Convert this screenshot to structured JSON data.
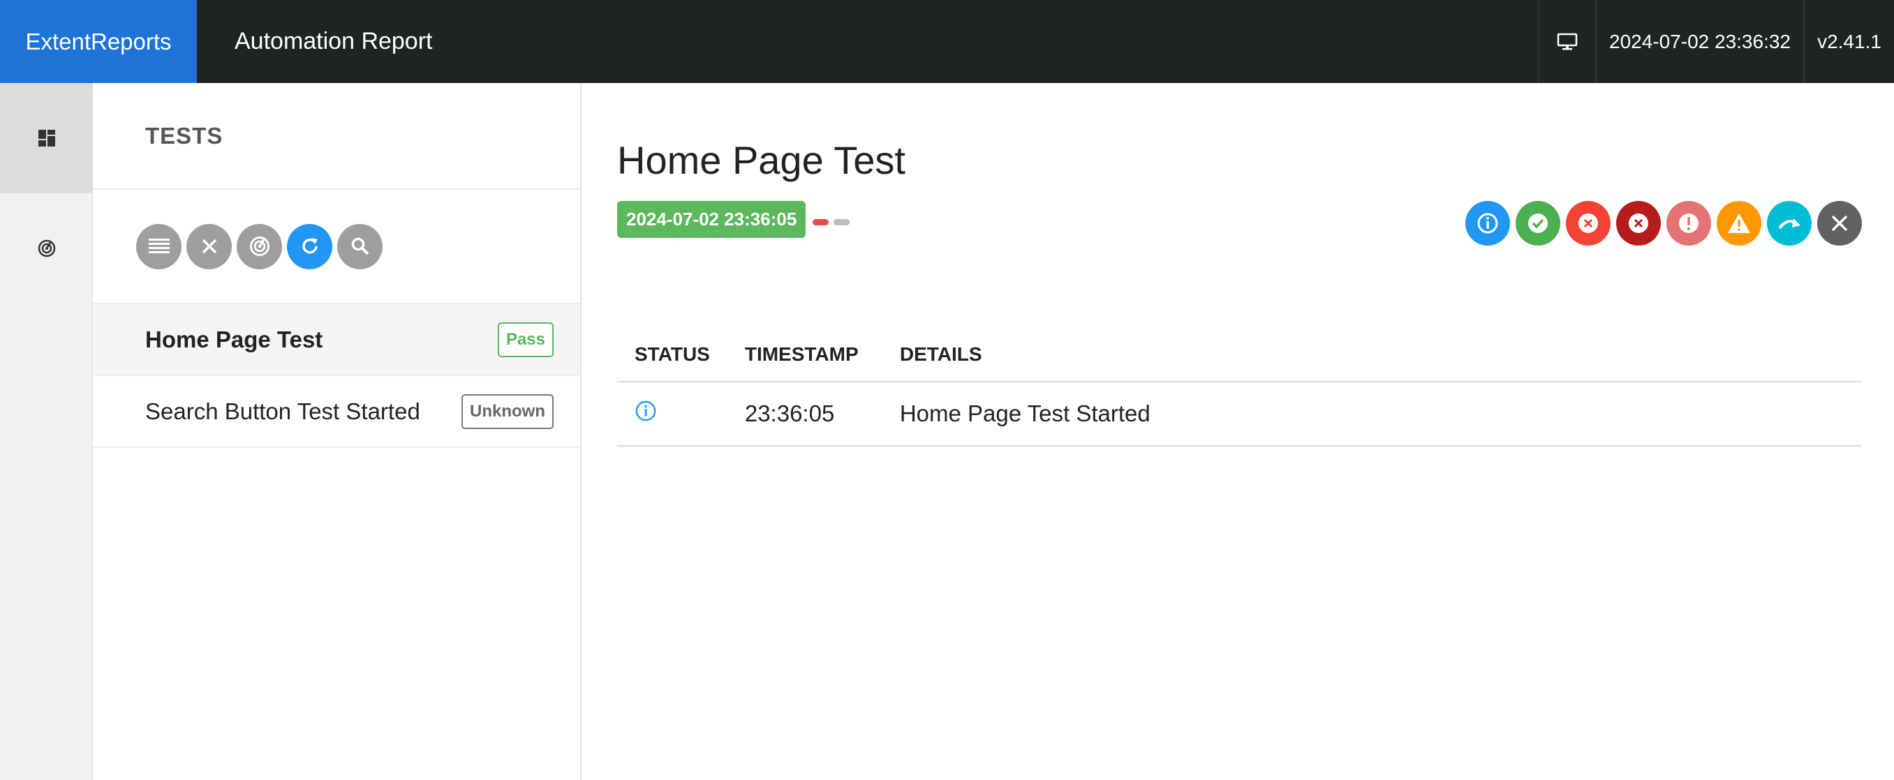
{
  "header": {
    "brand": "ExtentReports",
    "report_name": "Automation Report",
    "datetime": "2024-07-02 23:36:32",
    "version": "v2.41.1",
    "monitor_icon": "monitor-icon"
  },
  "rail": {
    "items": [
      {
        "icon": "dashboard-icon",
        "active": true
      },
      {
        "icon": "radar-icon",
        "active": false
      }
    ]
  },
  "test_list": {
    "header": "TESTS",
    "toolbar": [
      "list-icon",
      "close-icon",
      "radar-icon",
      "refresh-icon",
      "search-icon"
    ],
    "tests": [
      {
        "name": "Home Page Test",
        "status": "Pass",
        "selected": true
      },
      {
        "name": "Search Button Test Started",
        "status": "Unknown",
        "selected": false
      }
    ]
  },
  "detail": {
    "title": "Home Page Test",
    "started": "2024-07-02 23:36:05",
    "filters": [
      {
        "icon": "info-icon",
        "color": "#2196f3"
      },
      {
        "icon": "check-icon",
        "color": "#4caf50"
      },
      {
        "icon": "fail-icon",
        "color": "#f44336"
      },
      {
        "icon": "fatal-icon",
        "color": "#b71c1c"
      },
      {
        "icon": "error-icon",
        "color": "#e57373"
      },
      {
        "icon": "warning-icon",
        "color": "#ff9800"
      },
      {
        "icon": "skip-icon",
        "color": "#00bcd4"
      },
      {
        "icon": "clear-icon",
        "color": "#616161"
      }
    ],
    "table": {
      "headers": [
        "STATUS",
        "TIMESTAMP",
        "DETAILS"
      ],
      "rows": [
        {
          "status_icon": "info-icon",
          "timestamp": "23:36:05",
          "details": "Home Page Test Started"
        }
      ]
    }
  },
  "colors": {
    "brand": "#1e73d7",
    "navbar": "#1e2421",
    "pass": "#5cb85c",
    "accent": "#2196f3"
  }
}
